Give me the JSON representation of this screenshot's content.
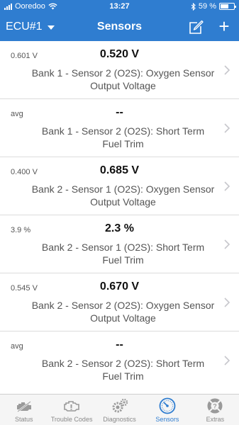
{
  "status_bar": {
    "carrier": "Ooredoo",
    "time": "13:27",
    "battery": "59 %",
    "battery_level": 0.59
  },
  "nav": {
    "left_label": "ECU#1",
    "title": "Sensors"
  },
  "sensors": [
    {
      "sub": "0.601 V",
      "value": "0.520 V",
      "line1": "Bank 1 - Sensor 2 (O2S): Oxygen Sensor",
      "line2": "Output Voltage"
    },
    {
      "sub": "avg",
      "value": "--",
      "line1": "Bank 1 - Sensor 2 (O2S): Short Term",
      "line2": "Fuel Trim"
    },
    {
      "sub": "0.400 V",
      "value": "0.685 V",
      "line1": "Bank 2 - Sensor 1 (O2S): Oxygen Sensor",
      "line2": "Output Voltage"
    },
    {
      "sub": "3.9 %",
      "value": "2.3 %",
      "line1": "Bank 2 - Sensor 1 (O2S): Short Term",
      "line2": "Fuel Trim"
    },
    {
      "sub": "0.545 V",
      "value": "0.670 V",
      "line1": "Bank 2 - Sensor 2 (O2S): Oxygen Sensor",
      "line2": "Output Voltage"
    },
    {
      "sub": "avg",
      "value": "--",
      "line1": "Bank 2 - Sensor 2 (O2S): Short Term",
      "line2": "Fuel Trim"
    }
  ],
  "tabs": [
    {
      "label": "Status",
      "icon": "engine-icon"
    },
    {
      "label": "Trouble Codes",
      "icon": "check-engine-icon"
    },
    {
      "label": "Diagnostics",
      "icon": "gears-icon"
    },
    {
      "label": "Sensors",
      "icon": "gauge-icon"
    },
    {
      "label": "Extras",
      "icon": "help-icon"
    }
  ],
  "colors": {
    "accent": "#2f7dd0",
    "tab_inactive": "#8a8a8a"
  }
}
